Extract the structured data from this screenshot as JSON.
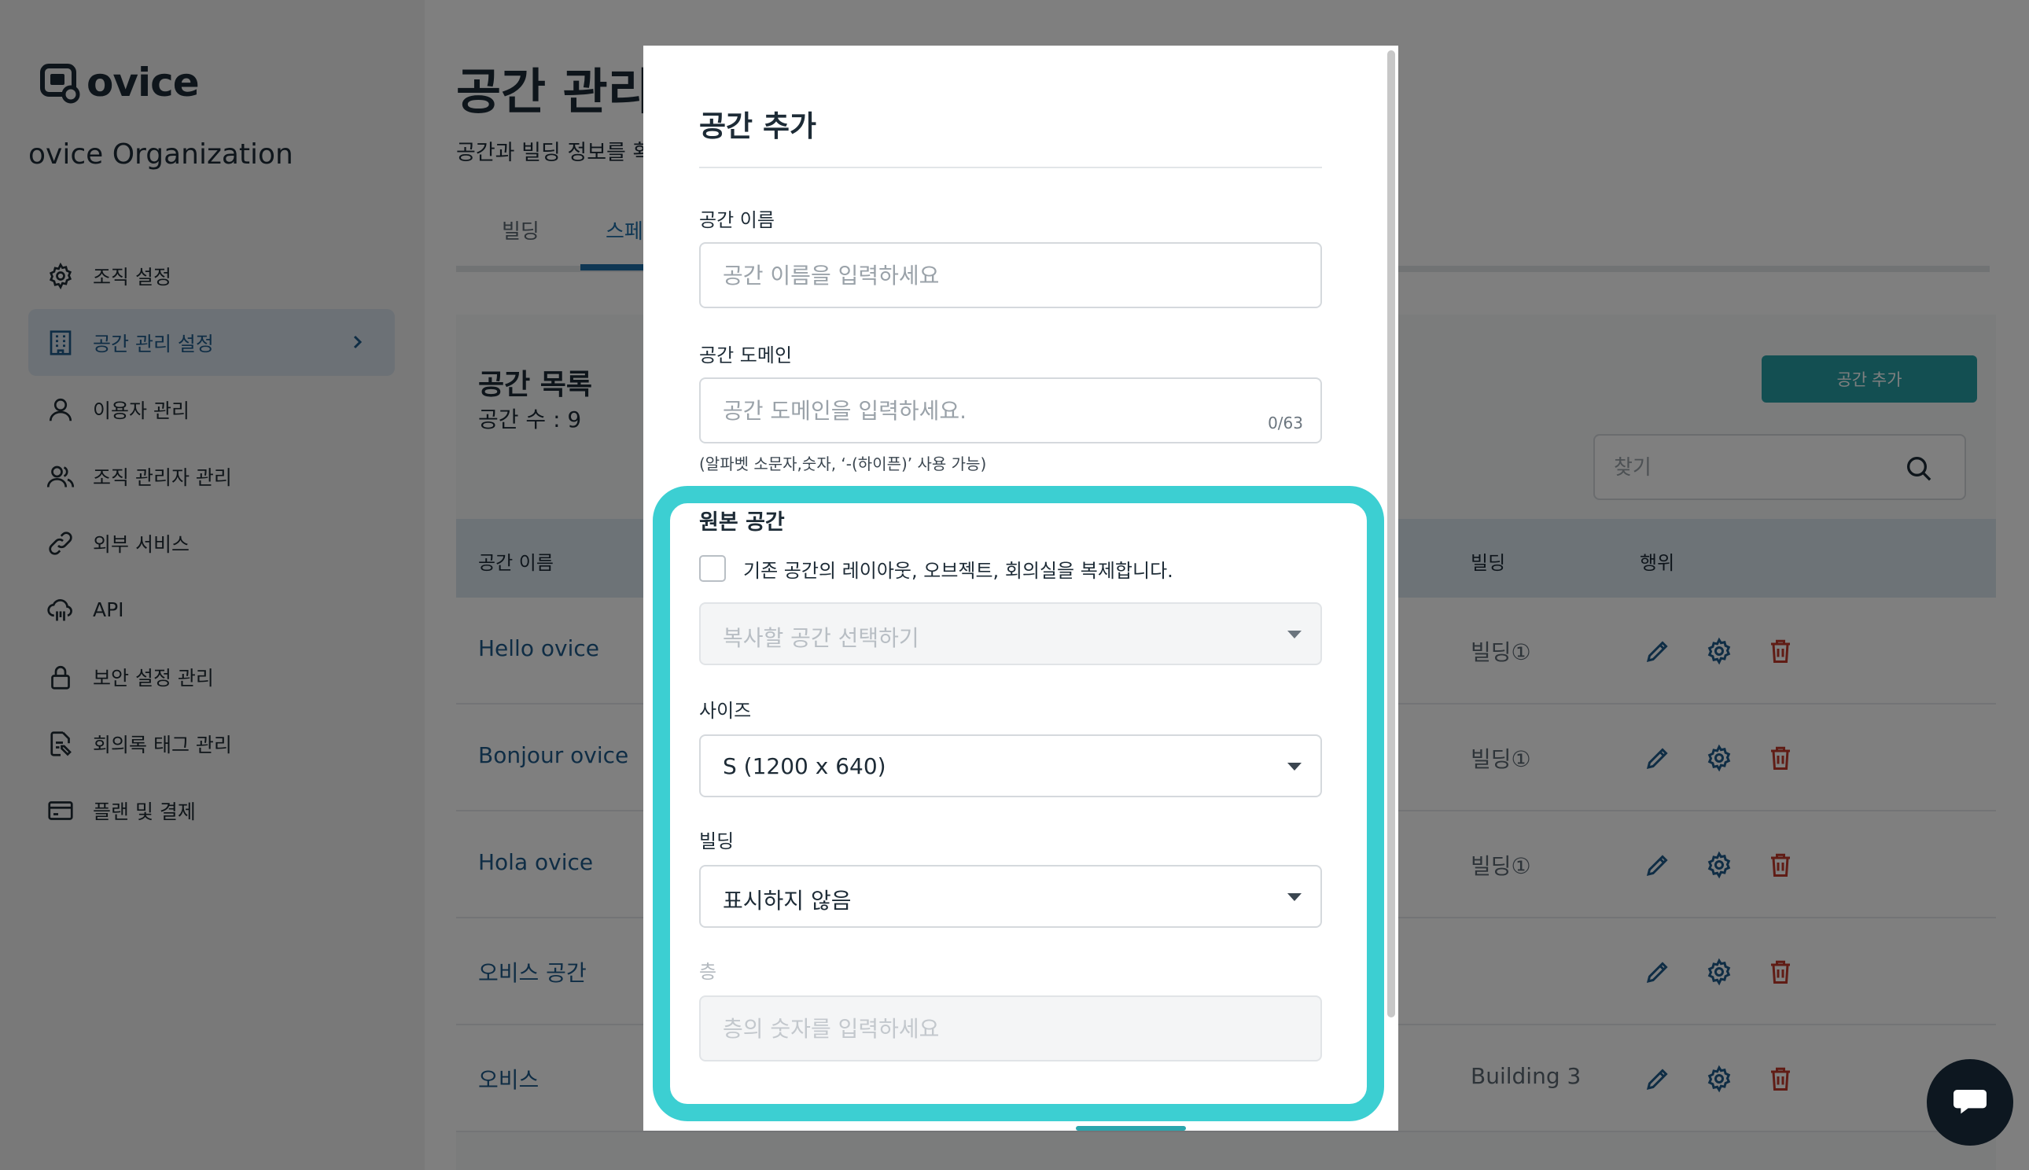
{
  "brand": {
    "name": "ovice",
    "organization": "ovice Organization",
    "accent": "#269fa4",
    "highlight": "#3ccfd2"
  },
  "sidebar": {
    "items": [
      {
        "label": "조직 설정",
        "icon": "gear-icon"
      },
      {
        "label": "공간 관리 설정",
        "icon": "building-icon",
        "active": true
      },
      {
        "label": "이용자 관리",
        "icon": "user-icon"
      },
      {
        "label": "조직 관리자 관리",
        "icon": "users-icon"
      },
      {
        "label": "외부 서비스",
        "icon": "link-icon"
      },
      {
        "label": "API",
        "icon": "cloud-api-icon"
      },
      {
        "label": "보안 설정 관리",
        "icon": "lock-icon"
      },
      {
        "label": "회의록 태그 관리",
        "icon": "document-tag-icon"
      },
      {
        "label": "플랜 및 결제",
        "icon": "credit-card-icon"
      }
    ]
  },
  "main": {
    "title": "공간 관리",
    "subtitle": "공간과 빌딩 정보를 확",
    "tabs": [
      {
        "label": "빌딩"
      },
      {
        "label": "스페"
      }
    ],
    "list_title": "공간 목록",
    "count_label": "공간 수 :  9",
    "add_button": "공간 추가",
    "search_placeholder": "찾기",
    "columns": {
      "name": "공간 이름",
      "building": "빌딩",
      "actions": "행위"
    },
    "rows": [
      {
        "name": "Hello ovice",
        "building": "빌딩①"
      },
      {
        "name": "Bonjour ovice",
        "building": "빌딩①"
      },
      {
        "name": "Hola ovice",
        "building": "빌딩①"
      },
      {
        "name": "오비스 공간",
        "building": ""
      },
      {
        "name": "오비스",
        "building": "Building 3"
      }
    ]
  },
  "modal": {
    "title": "공간 추가",
    "name_label": "공간 이름",
    "name_placeholder": "공간 이름을 입력하세요",
    "domain_label": "공간 도메인",
    "domain_placeholder": "공간 도메인을 입력하세요.",
    "domain_counter": "0/63",
    "domain_helper": "(알파벳 소문자,숫자, ‘-(하이픈)’ 사용 가능)",
    "source_label": "원본 공간",
    "copy_checkbox_label": "기존 공간의 레이아웃, 오브젝트, 회의실을 복제합니다.",
    "copy_select_placeholder": "복사할 공간 선택하기",
    "size_label": "사이즈",
    "size_value": "S (1200 x 640)",
    "building_label": "빌딩",
    "building_value": "표시하지 않음",
    "floor_label": "층",
    "floor_placeholder": "층의 숫자를 입력하세요"
  }
}
